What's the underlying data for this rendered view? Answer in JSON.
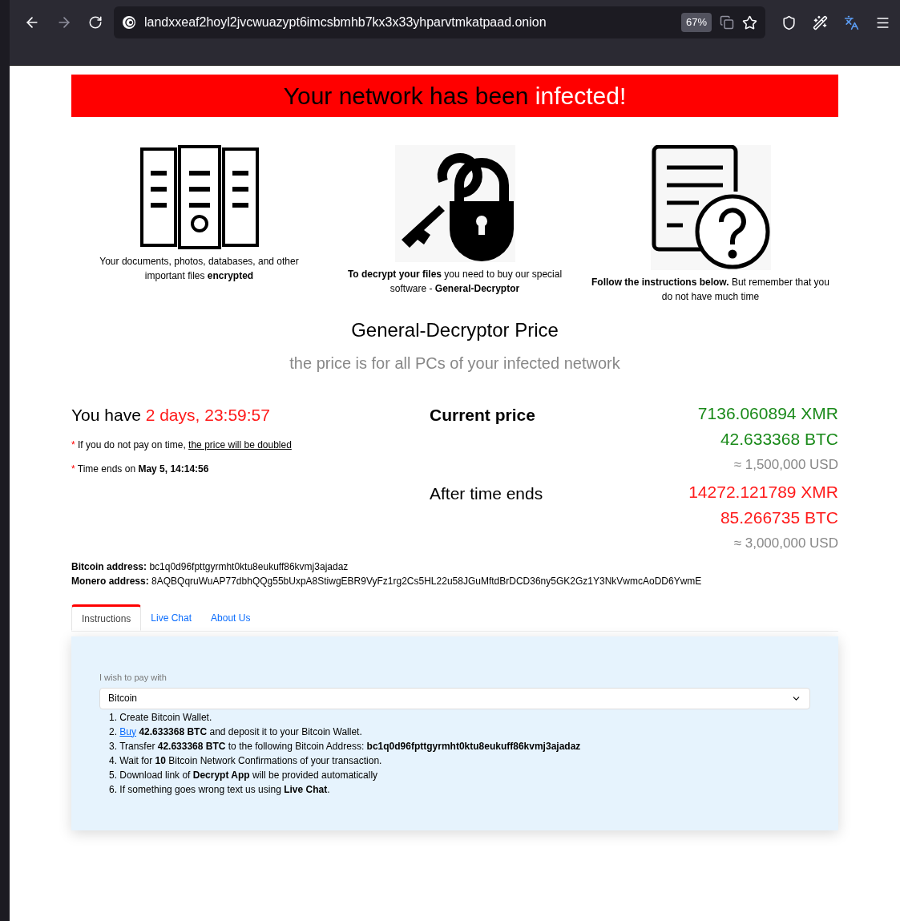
{
  "browser": {
    "url": "landxxeaf2hoyl2jvcwuazypt6imcsbmhb7kx3x33yhparvtmkatpaad.onion",
    "zoom": "67%"
  },
  "banner": {
    "text": "Your network has been",
    "highlight": "infected!"
  },
  "features": [
    {
      "kind": "servers",
      "caption": "Your documents, photos, databases, and other important files **encrypted**"
    },
    {
      "kind": "key-lock",
      "caption": "**To decrypt your files** you need to buy our special software - **General-Decryptor**"
    },
    {
      "kind": "document-question",
      "caption": "**Follow the instructions below.** But remember that you do not have much time"
    }
  ],
  "price_heading": {
    "title": "General-Decryptor Price",
    "subtitle": "the price is for all PCs of your infected network"
  },
  "timer": {
    "label": "You have",
    "remaining": "2 days, 23:59:57"
  },
  "notes": [
    {
      "mark": "*",
      "text": "If you do not pay on time,",
      "link": "the price will be doubled"
    },
    {
      "mark": "*",
      "text": "Time ends on **May 5, 14:14:56**"
    }
  ],
  "prices": [
    {
      "label": "Current price",
      "bold": true,
      "color": "#1a8a1a",
      "xmr": "7136.060894 XMR",
      "btc": "42.633368 BTC",
      "usd": "≈ 1,500,000 USD"
    },
    {
      "label": "After time ends",
      "bold": false,
      "color": "#ff1a1a",
      "xmr": "14272.121789 XMR",
      "btc": "85.266735 BTC",
      "usd": "≈ 3,000,000 USD"
    }
  ],
  "addresses": [
    {
      "label": "Bitcoin address:",
      "value": "bc1q0d96fpttgyrmht0ktu8eukuff86kvmj3ajadaz"
    },
    {
      "label": "Monero address:",
      "value": "8AQBQqruWuAP77dbhQQg55bUxpA8StiwgEBR9VyFz1rg2Cs5HL22u58JGuMftdBrDCD36ny5GK2Gz1Y3NkVwmcAoDD6YwmE"
    }
  ],
  "tabs": [
    {
      "label": "Instructions",
      "selected": true
    },
    {
      "label": "Live Chat",
      "selected": false
    },
    {
      "label": "About Us",
      "selected": false
    }
  ],
  "payment": {
    "label": "I wish to pay with",
    "value": "Bitcoin"
  },
  "steps": [
    {
      "number": "1.",
      "text": "Create Bitcoin Wallet."
    },
    {
      "number": "2.",
      "link": "Buy",
      "text": "**42.633368 BTC** and deposit it to your Bitcoin Wallet."
    },
    {
      "number": "3.",
      "text": "Transfer **42.633368 BTC** to the following Bitcoin Address: **bc1q0d96fpttgyrmht0ktu8eukuff86kvmj3ajadaz**"
    },
    {
      "number": "4.",
      "text": "Wait for **10** Bitcoin Network Confirmations of your transaction."
    },
    {
      "number": "5.",
      "text": "Download link of **Decrypt App** will be provided automatically"
    },
    {
      "number": "6.",
      "text": "If something goes wrong text us using **Live Chat**."
    }
  ]
}
